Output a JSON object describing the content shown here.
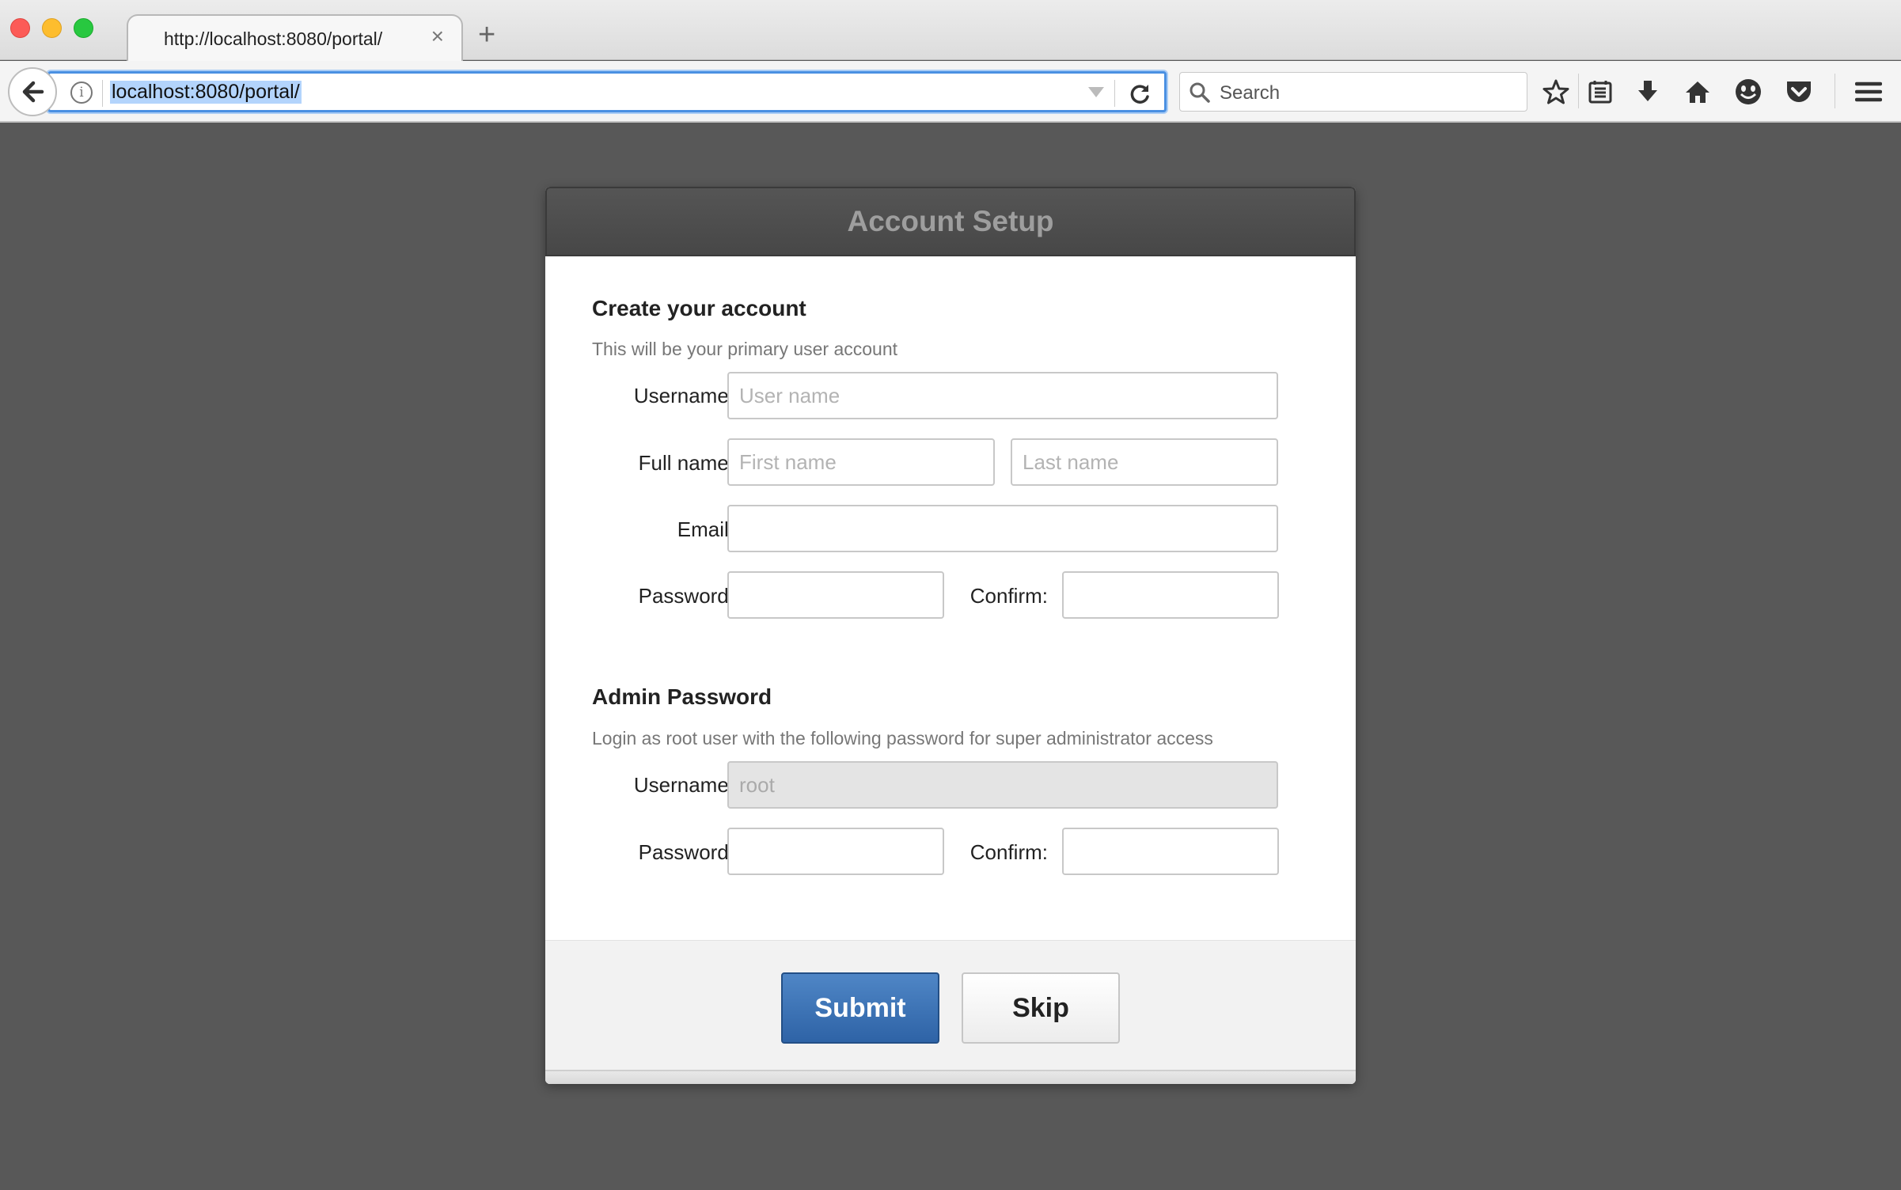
{
  "browser": {
    "tab": {
      "title": "http://localhost:8080/portal/",
      "close": "×"
    },
    "new_tab": "+",
    "url": "localhost:8080/portal/",
    "search_placeholder": "Search",
    "info_glyph": "i",
    "toolbar_icons": [
      "star-icon",
      "reading-list-icon",
      "download-icon",
      "home-icon",
      "emoji-icon",
      "pocket-icon",
      "menu-icon"
    ]
  },
  "dialog": {
    "title": "Account Setup",
    "account": {
      "title": "Create your account",
      "subtitle": "This will be your primary user account",
      "username_label": "Username:",
      "username_placeholder": "User name",
      "fullname_label": "Full name:",
      "firstname_placeholder": "First name",
      "lastname_placeholder": "Last name",
      "email_label": "Email:",
      "password_label": "Password:",
      "confirm_label": "Confirm:"
    },
    "admin": {
      "title": "Admin Password",
      "subtitle": "Login as root user with the following password for super administrator access",
      "username_label": "Username:",
      "username_value": "root",
      "password_label": "Password:",
      "confirm_label": "Confirm:"
    },
    "submit_label": "Submit",
    "skip_label": "Skip"
  },
  "colors": {
    "page_bg": "#585858",
    "url_focus": "#4a90e2",
    "submit_bg": "#3a70b3",
    "header_text": "#9e9e9e"
  }
}
